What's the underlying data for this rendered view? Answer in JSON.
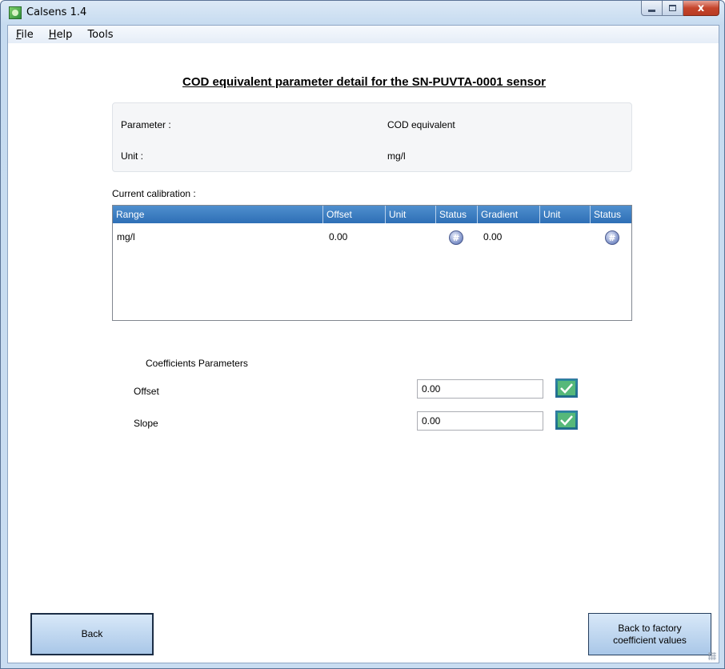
{
  "window": {
    "title": "Calsens 1.4",
    "close_glyph": "x"
  },
  "menu": {
    "items": [
      {
        "mnemonic": "F",
        "rest": "ile"
      },
      {
        "mnemonic": "H",
        "rest": "elp"
      },
      {
        "mnemonic": "",
        "rest": "Tools"
      }
    ]
  },
  "page": {
    "title": "COD equivalent parameter detail for the SN-PUVTA-0001 sensor"
  },
  "details": {
    "parameter_label": "Parameter :",
    "parameter_value": "COD equivalent",
    "unit_label": "Unit :",
    "unit_value": "mg/l"
  },
  "calibration": {
    "label": "Current calibration :",
    "columns": [
      "Range",
      "Offset",
      "Unit",
      "Status",
      "Gradient",
      "Unit",
      "Status"
    ],
    "rows": [
      {
        "range": "mg/l",
        "offset": "0.00",
        "offset_unit": "",
        "offset_status": "pending-icon",
        "gradient": "0.00",
        "gradient_unit": "",
        "gradient_status": "pending-icon"
      }
    ]
  },
  "coefficients": {
    "title": "Coefficients Parameters",
    "offset_label": "Offset",
    "offset_value": "0.00",
    "slope_label": "Slope",
    "slope_value": "0.00"
  },
  "buttons": {
    "back": "Back",
    "factory_line1": "Back to factory",
    "factory_line2": "coefficient values"
  },
  "colors": {
    "accent": "#2e6fb6",
    "check": "#1d6e86"
  }
}
